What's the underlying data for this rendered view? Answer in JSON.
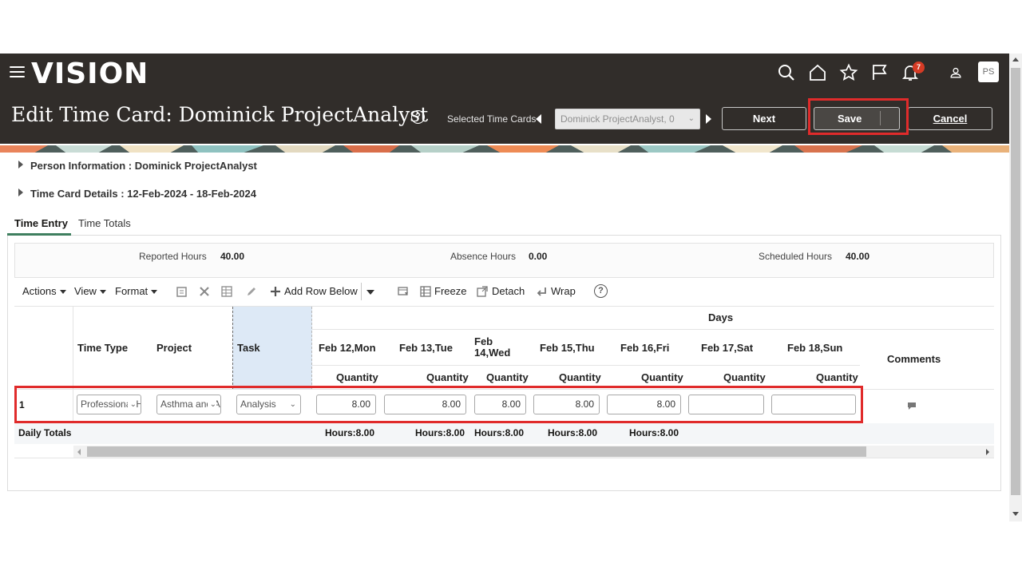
{
  "app": {
    "logo": "VISION",
    "notification_count": "7",
    "avatar_initials": "PS"
  },
  "header": {
    "title": "Edit Time Card: Dominick ProjectAnalyst",
    "selected_label": "Selected Time Cards",
    "selected_value": "Dominick ProjectAnalyst, 0",
    "next_label": "Next",
    "save_label": "Save",
    "cancel_label": "Cancel"
  },
  "sections": {
    "person_info": "Person Information : Dominick ProjectAnalyst",
    "time_card_details": "Time Card Details : 12-Feb-2024 - 18-Feb-2024"
  },
  "tabs": [
    {
      "label": "Time Entry",
      "active": true
    },
    {
      "label": "Time Totals",
      "active": false
    }
  ],
  "summary": {
    "reported_label": "Reported Hours",
    "reported_value": "40.00",
    "absence_label": "Absence Hours",
    "absence_value": "0.00",
    "scheduled_label": "Scheduled Hours",
    "scheduled_value": "40.00"
  },
  "toolbar": {
    "actions": "Actions",
    "view": "View",
    "format": "Format",
    "add_row_below": "Add Row Below",
    "freeze": "Freeze",
    "detach": "Detach",
    "wrap": "Wrap"
  },
  "table": {
    "days_header": "Days",
    "col_time_type": "Time Type",
    "col_project": "Project",
    "col_task": "Task",
    "col_comments": "Comments",
    "day_headers": [
      "Feb 12,Mon",
      "Feb 13,Tue",
      "Feb\n14,Wed",
      "Feb 15,Thu",
      "Feb 16,Fri",
      "Feb 17,Sat",
      "Feb 18,Sun"
    ],
    "quantity_label": "Quantity",
    "row": {
      "number": "1",
      "time_type": "Professional Hours",
      "project": "Asthma and Allergy",
      "task": "Analysis",
      "quantities": [
        "8.00",
        "8.00",
        "8.00",
        "8.00",
        "8.00",
        "",
        ""
      ]
    },
    "totals_label": "Daily Totals",
    "totals": [
      "Hours:8.00",
      "Hours:8.00",
      "Hours:8.00",
      "Hours:8.00",
      "Hours:8.00"
    ]
  },
  "colors": {
    "header_bg": "#312d2a",
    "highlight": "#e02b2b",
    "tab_accent": "#3f7f5f"
  }
}
